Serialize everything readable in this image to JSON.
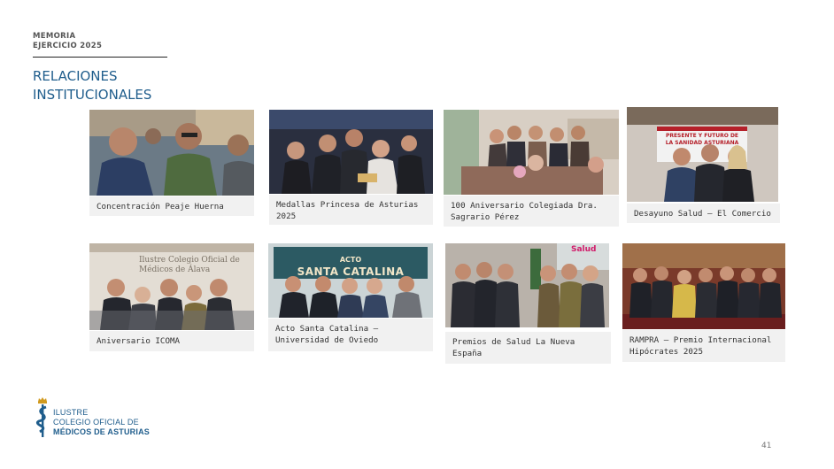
{
  "header": {
    "memoria": "MEMORIA",
    "ejercicio": "EJERCICIO 2025"
  },
  "title": {
    "line1": "RELACIONES",
    "line2": "INSTITUCIONALES"
  },
  "events": [
    {
      "caption": "Concentración Peaje Huerna"
    },
    {
      "caption": "Medallas Princesa de Asturias 2025"
    },
    {
      "caption": "100 Aniversario Colegiada Dra. Sagrario Pérez"
    },
    {
      "caption": "Desayuno Salud – El Comercio",
      "banner": "PRESENTE Y FUTURO DE LA SANIDAD ASTURIANA"
    },
    {
      "caption": "Aniversario ICOMA",
      "banner": "Ilustre Colegio Oficial de Médicos de Álava"
    },
    {
      "caption": "Acto Santa Catalina – Universidad de Oviedo",
      "banner_line1": "ACTO",
      "banner_line2": "SANTA CATALINA"
    },
    {
      "caption": "Premios de Salud La Nueva España",
      "banner": "Salud"
    },
    {
      "caption": "RAMPRA – Premio Internacional Hipócrates 2025"
    }
  ],
  "logo": {
    "line1": "ILUSTRE",
    "line2": "COLEGIO OFICIAL DE",
    "line3": "MÉDICOS DE ASTURIAS"
  },
  "page_number": "41"
}
